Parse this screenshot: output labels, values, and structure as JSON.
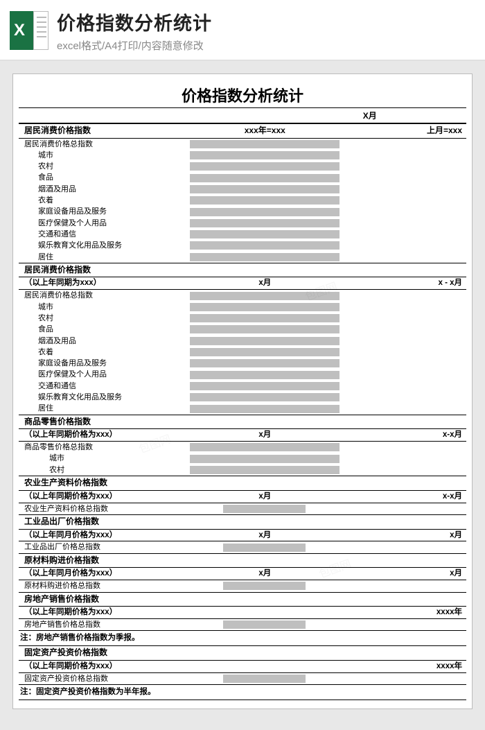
{
  "header": {
    "title": "价格指数分析统计",
    "subtitle": "excel格式/A4打印/内容随意修改"
  },
  "doc": {
    "title": "价格指数分析统计",
    "period": "X月"
  },
  "s1": {
    "head": "居民消费价格指数",
    "col1": "xxx年=xxx",
    "col2": "上月=xxx",
    "rows": [
      "居民消费价格总指数",
      "城市",
      "农村",
      "食品",
      "烟酒及用品",
      "衣着",
      "家庭设备用品及服务",
      "医疗保健及个人用品",
      "交通和通信",
      "娱乐教育文化用品及服务",
      "居住"
    ]
  },
  "s2": {
    "head": "居民消费价格指数",
    "sub": "（以上年同期为xxx）",
    "col1": "x月",
    "col2": "x - x月",
    "rows": [
      "居民消费价格总指数",
      "城市",
      "农村",
      "食品",
      "烟酒及用品",
      "衣着",
      "家庭设备用品及服务",
      "医疗保健及个人用品",
      "交通和通信",
      "娱乐教育文化用品及服务",
      "居住"
    ]
  },
  "s3": {
    "head": "商品零售价格指数",
    "sub": "（以上年同期价格为xxx）",
    "col1": "x月",
    "col2": "x-x月",
    "rows": [
      "商品零售价格总指数",
      "城市",
      "农村"
    ]
  },
  "s4": {
    "head": "农业生产资料价格指数",
    "sub": "（以上年同期价格为xxx）",
    "col1": "x月",
    "col2": "x-x月",
    "rows": [
      "农业生产资料价格总指数"
    ]
  },
  "s5": {
    "head": "工业品出厂价格指数",
    "sub": "（以上年同月价格为xxx）",
    "col1": "x月",
    "col2": "x月",
    "rows": [
      "工业品出厂价格总指数"
    ]
  },
  "s6": {
    "head": "原材料购进价格指数",
    "sub": "（以上年同月价格为xxx）",
    "col1": "x月",
    "col2": "x月",
    "rows": [
      "原材料购进价格总指数"
    ]
  },
  "s7": {
    "head": "房地产销售价格指数",
    "sub": "（以上年同期价格为xxx）",
    "col1": "",
    "col2": "xxxx年",
    "rows": [
      "房地产销售价格总指数"
    ],
    "note": "注：房地产销售价格指数为季报。"
  },
  "s8": {
    "head": "固定资产投资价格指数",
    "sub": "（以上年同期价格为xxx）",
    "col1": "",
    "col2": "xxxx年",
    "rows": [
      "固定资产投资价格总指数"
    ],
    "note": "注：固定资产投资价格指数为半年报。"
  }
}
